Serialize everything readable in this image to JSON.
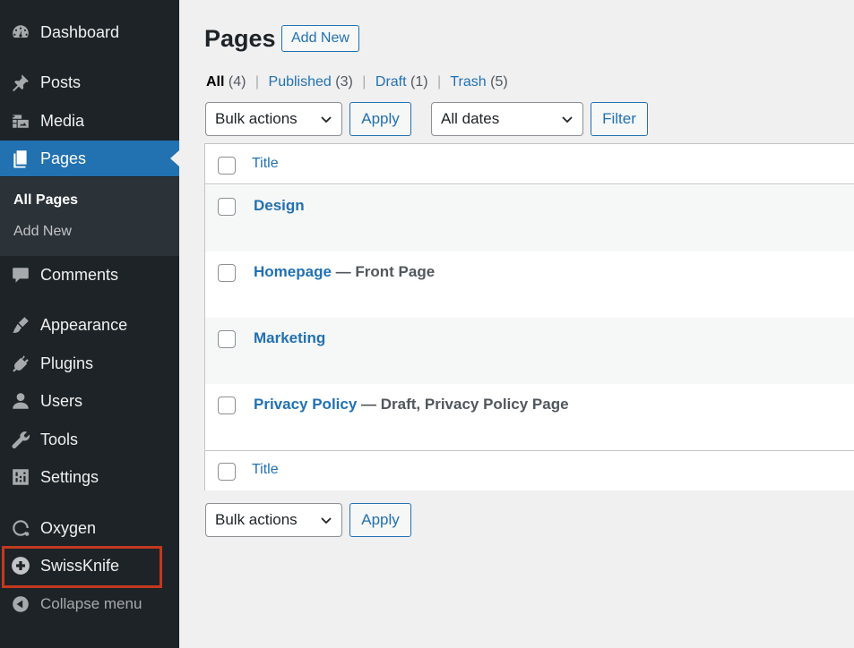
{
  "sidebar": {
    "items": [
      {
        "label": "Dashboard",
        "icon": "dashboard-icon"
      },
      {
        "label": "Posts",
        "icon": "pin-icon"
      },
      {
        "label": "Media",
        "icon": "media-icon"
      },
      {
        "label": "Pages",
        "icon": "pages-icon",
        "current": true
      },
      {
        "label": "Comments",
        "icon": "comment-icon"
      },
      {
        "label": "Appearance",
        "icon": "brush-icon"
      },
      {
        "label": "Plugins",
        "icon": "plug-icon"
      },
      {
        "label": "Users",
        "icon": "user-icon"
      },
      {
        "label": "Tools",
        "icon": "wrench-icon"
      },
      {
        "label": "Settings",
        "icon": "settings-icon"
      },
      {
        "label": "Oxygen",
        "icon": "oxygen-icon"
      },
      {
        "label": "SwissKnife",
        "icon": "plus-circle-icon"
      }
    ],
    "submenu": [
      {
        "label": "All Pages",
        "current": true
      },
      {
        "label": "Add New"
      }
    ],
    "collapse_label": "Collapse menu"
  },
  "header": {
    "title": "Pages",
    "add_new_label": "Add New"
  },
  "filters": {
    "all_label": "All",
    "all_count": "(4)",
    "published_label": "Published",
    "published_count": "(3)",
    "draft_label": "Draft",
    "draft_count": "(1)",
    "trash_label": "Trash",
    "trash_count": "(5)",
    "separator": "|"
  },
  "toolbar": {
    "bulk_actions": "Bulk actions",
    "apply_label": "Apply",
    "all_dates": "All dates",
    "filter_label": "Filter"
  },
  "table": {
    "column_title": "Title",
    "rows": [
      {
        "title": "Design",
        "state": ""
      },
      {
        "title": "Homepage",
        "state": " — Front Page"
      },
      {
        "title": "Marketing",
        "state": ""
      },
      {
        "title": "Privacy Policy",
        "state": " — Draft, Privacy Policy Page"
      }
    ]
  },
  "colors": {
    "sidebar_bg": "#1d2327",
    "accent": "#2271b1",
    "highlight": "#c3381f"
  }
}
